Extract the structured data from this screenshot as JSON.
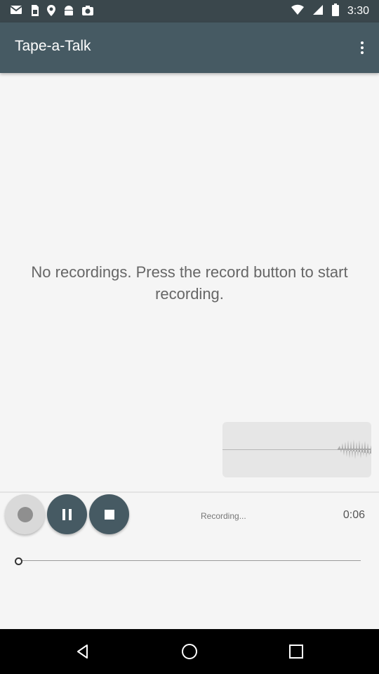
{
  "status_bar": {
    "time": "3:30",
    "icons": [
      "gmail-icon",
      "sim-icon",
      "location-icon",
      "android-icon",
      "camera-icon",
      "wifi-icon",
      "signal-icon",
      "battery-icon"
    ]
  },
  "app_bar": {
    "title": "Tape-a-Talk",
    "menu_icon": "more-vert-icon"
  },
  "main": {
    "empty_message": "No recordings. Press the record button to start recording."
  },
  "player": {
    "status": "Recording...",
    "time": "0:06",
    "progress_fraction": 0.0,
    "buttons": {
      "record_icon": "record-icon",
      "pause_icon": "pause-icon",
      "stop_icon": "stop-icon"
    }
  },
  "nav_bar": {
    "icons": [
      "back-icon",
      "home-icon",
      "recents-icon"
    ]
  },
  "colors": {
    "status_bar": "#3a474c",
    "app_bar": "#465a63",
    "background": "#f5f5f5",
    "control_button": "#465a63"
  }
}
